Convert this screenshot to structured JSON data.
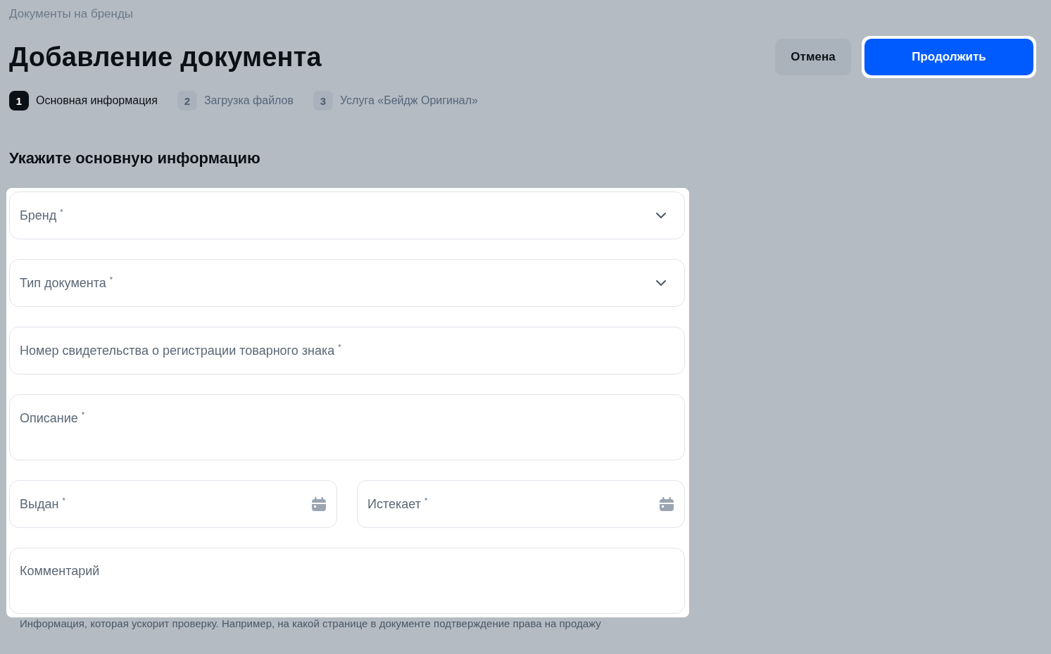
{
  "breadcrumb": "Документы на бренды",
  "title": "Добавление документа",
  "buttons": [
    {
      "label": "Отмена",
      "kind": "secondary"
    },
    {
      "label": "Продолжить",
      "kind": "primary",
      "highlighted": true
    }
  ],
  "steps": [
    {
      "number": "1",
      "label": "Основная информация",
      "selected": true
    },
    {
      "number": "2",
      "label": "Загрузка файлов",
      "selected": false
    },
    {
      "number": "3",
      "label": "Услуга «Бейдж Оригинал»",
      "selected": false
    }
  ],
  "section_title": "Укажите основную информацию",
  "fields": [
    {
      "kind": "select",
      "placeholder": "Бренд $^{*}$"
    },
    {
      "kind": "select",
      "placeholder": "Тип документа $^{*}$"
    },
    {
      "kind": "text",
      "placeholder": "Номер свидетельства о регистрации товарного знака $^{*}$"
    },
    {
      "kind": "textarea",
      "placeholder": "Описание $^{*}$"
    },
    {
      "kind": "date",
      "placeholder": "Выдан $^{*}$"
    },
    {
      "kind": "date",
      "placeholder": "Истекает $^{*}$"
    },
    {
      "kind": "textarea",
      "placeholder": "Комментарий",
      "hint": "Информация, которая ускорит проверку. Например, на какой странице в документе подтверждение права на продажу"
    }
  ]
}
